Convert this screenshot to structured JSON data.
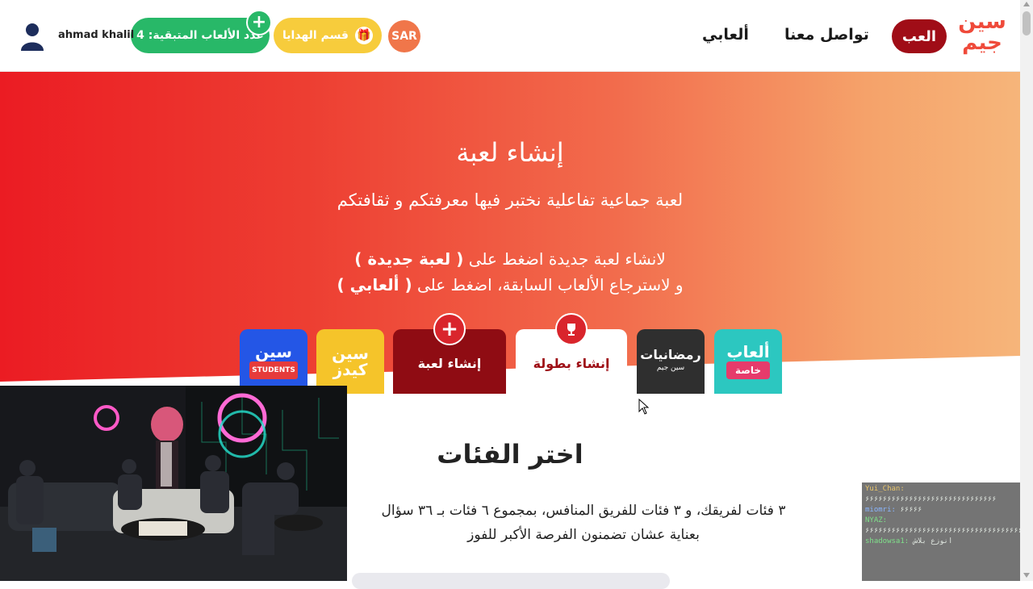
{
  "header": {
    "logo_line1": "سين",
    "logo_line2": "جيم",
    "play_label": "العب",
    "nav_contact": "تواصل معنا",
    "nav_my_games": "ألعابي",
    "currency": "SAR",
    "gifts_label": "قسم الهدايا",
    "remaining_games_label": "عدد الألعاب المتبقية: 4",
    "username": "ahmad khalil"
  },
  "hero": {
    "title": "إنشاء لعبة",
    "subtitle": "لعبة جماعية تفاعلية نختبر فيها معرفتكم و ثقافتكم",
    "line1_prefix": "لانشاء لعبة جديدة اضغط على",
    "line1_bold": "( لعبة جديدة )",
    "line2_prefix": "و لاسترجاع الألعاب السابقة، اضغط على",
    "line2_bold": "( ألعابي )"
  },
  "cards": {
    "special_main": "ألعاب",
    "special_tag": "خاصة",
    "ramadan_main": "رمضانيات",
    "ramadan_tag": "سين جيم",
    "tournament": "إنشاء بطولة",
    "create_game": "إنشاء لعبة",
    "kids_line1": "سين",
    "kids_line2": "كيدز",
    "students_main": "سين",
    "students_tag": "STUDENTS"
  },
  "categories": {
    "title": "اختر الفئات",
    "desc_line1": "٣ فئات لفريقك، و ٣ فئات للفريق المنافس، بمجموع ٦ فئات بـ ٣٦ سؤال",
    "desc_line2": "بعناية عشان تضمنون الفرصة الأكبر للفوز"
  },
  "chat": {
    "messages": [
      {
        "user": "Yui_Chan:",
        "text": "۶۶۶۶۶۶۶۶۶۶۶۶۶۶۶۶۶۶۶۶۶۶۶۶۶۶۶۶۶۶"
      },
      {
        "user": "miomri:",
        "text": "۶۶۶۶۶"
      },
      {
        "user": "NYAZ:",
        "text": "۶۶۶۶۶۶۶۶۶۶۶۶۶۶۶۶۶۶۶۶۶۶۶۶۶۶۶۶۶۶۶۶۶۶۶۶۶۶۶۶"
      },
      {
        "user": "shadowsa1:",
        "text": "انوزع بلاش"
      }
    ]
  },
  "colors": {
    "brand_red": "#a00d17",
    "logo_red": "#ef4a3a",
    "green": "#28b868",
    "yellow": "#f7cc3c",
    "orange": "#f0764a"
  }
}
